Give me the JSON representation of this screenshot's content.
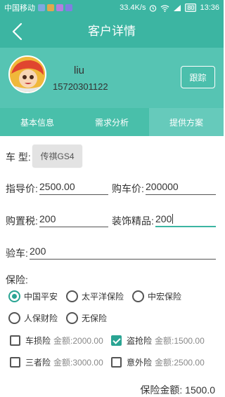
{
  "status_bar": {
    "carrier": "中国移动",
    "speed": "33.4K/s",
    "battery": "80",
    "time": "13:36"
  },
  "header": {
    "title": "客户详情"
  },
  "profile": {
    "name": "liu",
    "phone": "15720301122",
    "follow_label": "跟踪"
  },
  "tabs": [
    {
      "label": "基本信息"
    },
    {
      "label": "需求分析"
    },
    {
      "label": "提供方案"
    }
  ],
  "form": {
    "car_type_label": "车 型:",
    "car_type_value": "传祺GS4",
    "guide_price_label": "指导价:",
    "guide_price_value": "2500.00",
    "purchase_price_label": "购车价:",
    "purchase_price_value": "200000",
    "purchase_tax_label": "购置税:",
    "purchase_tax_value": "200",
    "decor_label": "装饰精品:",
    "decor_value": "200",
    "inspection_label": "验车:",
    "inspection_value": "200"
  },
  "insurance": {
    "label": "保险:",
    "companies": [
      {
        "label": "中国平安",
        "selected": true
      },
      {
        "label": "太平洋保险",
        "selected": false
      },
      {
        "label": "中宏保险",
        "selected": false
      },
      {
        "label": "人保财险",
        "selected": false
      },
      {
        "label": "无保险",
        "selected": false
      }
    ],
    "amount_label": "金额:",
    "types": [
      {
        "label": "车损险",
        "amount": "2000.00",
        "checked": false
      },
      {
        "label": "盗抢险",
        "amount": "1500.00",
        "checked": true
      },
      {
        "label": "三者险",
        "amount": "3000.00",
        "checked": false
      },
      {
        "label": "意外险",
        "amount": "2500.00",
        "checked": false
      }
    ],
    "total_label": "保险金额:",
    "total_value": "1500.0"
  },
  "colors": {
    "primary": "#3cb5a2",
    "profile_bg": "#56c4b3",
    "tab_bg": "#49bfaa",
    "tab_active_bg": "#66cabb",
    "accent": "#2aa493"
  }
}
